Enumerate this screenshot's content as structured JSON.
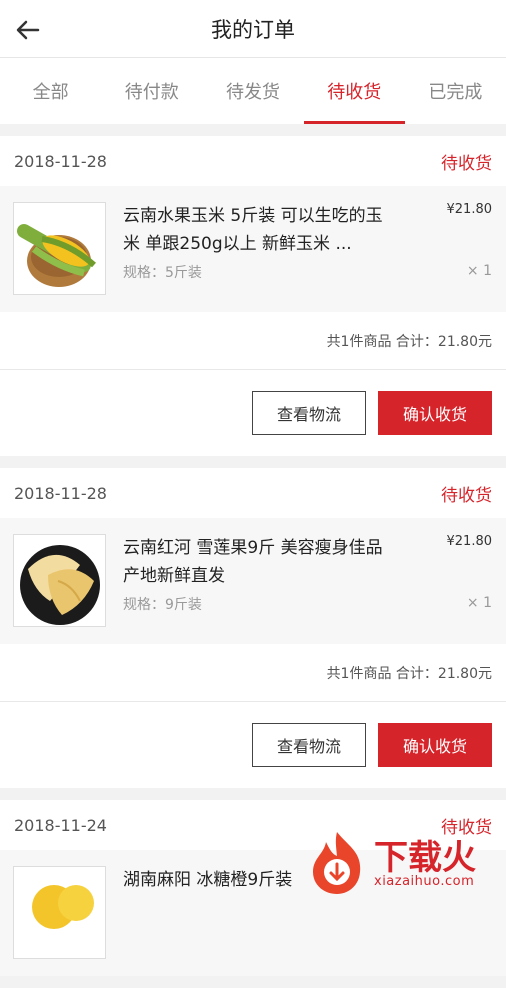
{
  "header": {
    "title": "我的订单"
  },
  "tabs": [
    {
      "label": "全部"
    },
    {
      "label": "待付款"
    },
    {
      "label": "待发货"
    },
    {
      "label": "待收货"
    },
    {
      "label": "已完成"
    }
  ],
  "orders": [
    {
      "date": "2018-11-28",
      "status": "待收货",
      "name": "云南水果玉米 5斤装 可以生吃的玉米 单跟250g以上 新鲜玉米 ...",
      "spec": "规格：5斤装",
      "price": "¥21.80",
      "qty": "× 1",
      "total": "共1件商品 合计：21.80元",
      "btn_logistics": "查看物流",
      "btn_confirm": "确认收货"
    },
    {
      "date": "2018-11-28",
      "status": "待收货",
      "name": "云南红河 雪莲果9斤 美容瘦身佳品 产地新鲜直发",
      "spec": "规格：9斤装",
      "price": "¥21.80",
      "qty": "× 1",
      "total": "共1件商品 合计：21.80元",
      "btn_logistics": "查看物流",
      "btn_confirm": "确认收货"
    },
    {
      "date": "2018-11-24",
      "status": "待收货",
      "name": "湖南麻阳 冰糖橙9斤装"
    }
  ],
  "watermark": {
    "text": "下载火",
    "sub": "xiazaihuo.com"
  }
}
